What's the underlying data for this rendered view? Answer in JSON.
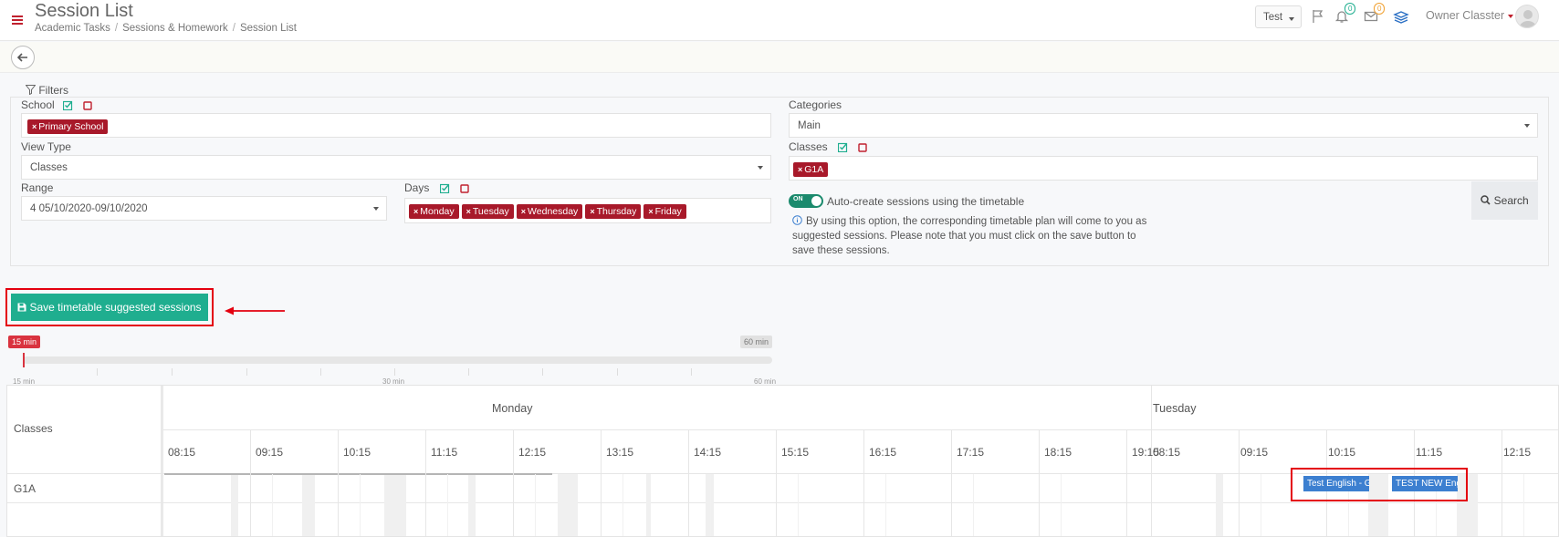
{
  "header": {
    "title": "Session List",
    "breadcrumb": [
      "Academic Tasks",
      "Sessions & Homework",
      "Session List"
    ],
    "test_label": "Test",
    "notifications_count": "0",
    "messages_count": "0",
    "user_name": "Owner Classter"
  },
  "filters": {
    "legend": "Filters",
    "school_label": "School",
    "school_tags": [
      "Primary School"
    ],
    "view_type_label": "View Type",
    "view_type_value": "Classes",
    "range_label": "Range",
    "range_value": "4 05/10/2020-09/10/2020",
    "days_label": "Days",
    "days_tags": [
      "Monday",
      "Tuesday",
      "Wednesday",
      "Thursday",
      "Friday"
    ],
    "categories_label": "Categories",
    "categories_value": "Main",
    "classes_label": "Classes",
    "classes_tags": [
      "G1A"
    ],
    "toggle_on": "ON",
    "auto_create_label": "Auto-create sessions using the timetable",
    "info_text": "By using this option, the corresponding timetable plan will come to you as suggested sessions. Please note that you must click on the save button to save these sessions.",
    "search_label": "Search"
  },
  "actions": {
    "save_label": "Save timetable suggested sessions"
  },
  "slider": {
    "current": "15 min",
    "max_badge": "60 min",
    "min_label": "15 min",
    "mid_label": "30 min",
    "max_label": "60 min",
    "value_minutes": 15
  },
  "scheduler": {
    "row_header": "Classes",
    "row_name": "G1A",
    "days": [
      {
        "name": "Monday",
        "times": [
          "08:15",
          "09:15",
          "10:15",
          "11:15",
          "12:15",
          "13:15",
          "14:15",
          "15:15",
          "16:15",
          "17:15",
          "18:15",
          "19:15"
        ]
      },
      {
        "name": "Tuesday",
        "times": [
          "08:15",
          "09:15",
          "10:15",
          "11:15",
          "12:15"
        ]
      }
    ],
    "events": [
      "Test English - G",
      "TEST NEW Engl"
    ]
  },
  "colors": {
    "brand_red": "#c0202e",
    "tag_red": "#a8192a",
    "save_green": "#1fae8f",
    "event_blue": "#3c7fd0",
    "highlight_red": "#e4000f"
  }
}
